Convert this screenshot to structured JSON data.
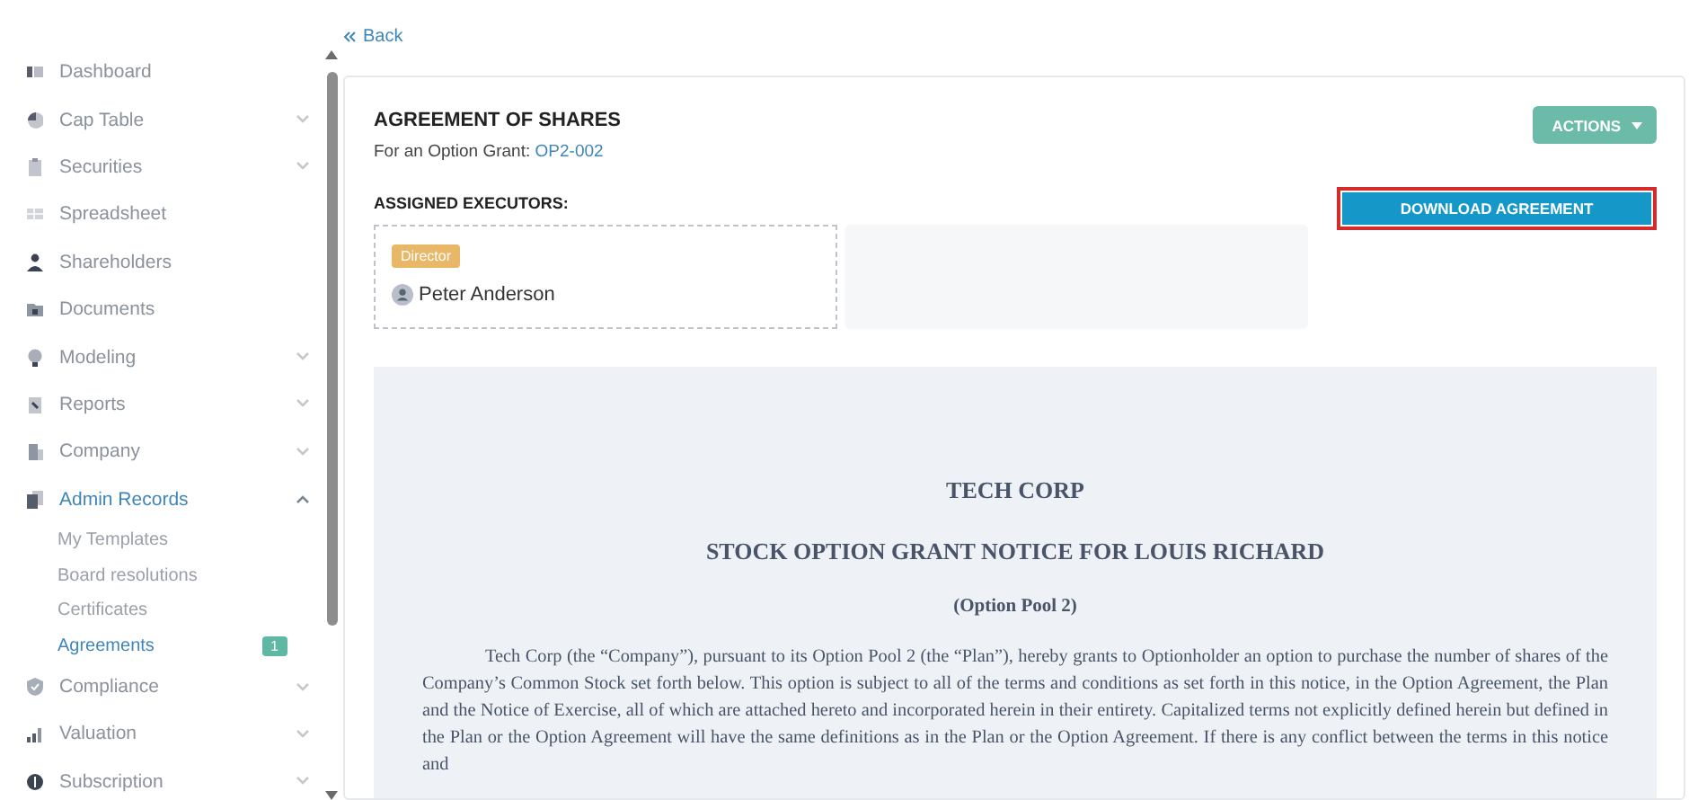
{
  "back_link": "Back",
  "sidebar": {
    "items": [
      {
        "label": "Dashboard",
        "expandable": false,
        "selected": false
      },
      {
        "label": "Cap Table",
        "expandable": true,
        "expanded": false,
        "selected": false
      },
      {
        "label": "Securities",
        "expandable": true,
        "expanded": false,
        "selected": false
      },
      {
        "label": "Spreadsheet",
        "expandable": false,
        "selected": false
      },
      {
        "label": "Shareholders",
        "expandable": false,
        "selected": false
      },
      {
        "label": "Documents",
        "expandable": false,
        "selected": false
      },
      {
        "label": "Modeling",
        "expandable": true,
        "expanded": false,
        "selected": false
      },
      {
        "label": "Reports",
        "expandable": true,
        "expanded": false,
        "selected": false
      },
      {
        "label": "Company",
        "expandable": true,
        "expanded": false,
        "selected": false
      },
      {
        "label": "Admin Records",
        "expandable": true,
        "expanded": true,
        "selected": true,
        "children": [
          {
            "label": "My Templates",
            "selected": false
          },
          {
            "label": "Board resolutions",
            "selected": false
          },
          {
            "label": "Certificates",
            "selected": false
          },
          {
            "label": "Agreements",
            "selected": true,
            "badge": "1"
          }
        ]
      },
      {
        "label": "Compliance",
        "expandable": true,
        "expanded": false,
        "selected": false
      },
      {
        "label": "Valuation",
        "expandable": true,
        "expanded": false,
        "selected": false
      },
      {
        "label": "Subscription",
        "expandable": true,
        "expanded": false,
        "selected": false
      }
    ]
  },
  "card": {
    "title": "AGREEMENT OF SHARES",
    "subtitle": "For an Option Grant:",
    "grant_link": "OP2-002",
    "actions_button": "ACTIONS",
    "executors_label": "ASSIGNED EXECUTORS:",
    "executors": [
      {
        "role": "Director",
        "name": "Peter Anderson"
      }
    ],
    "download_button": {
      "label": "DOWNLOAD AGREEMENT",
      "highlighted": true
    },
    "document": {
      "company": "TECH CORP",
      "heading": "STOCK OPTION GRANT NOTICE FOR LOUIS RICHARD",
      "subheading": "(Option Pool 2)",
      "paragraph": "Tech Corp (the “Company”), pursuant to its Option Pool 2 (the “Plan”), hereby grants to Optionholder an option to purchase the number of shares of the Company’s Common Stock set forth below. This option is subject to all of the terms and conditions as set forth in this notice, in the Option Agreement, the Plan and the Notice of Exercise, all of which are attached hereto and incorporated herein in their entirety. Capitalized terms not explicitly defined herein but defined in the Plan or the Option Agreement will have the same definitions as in the Plan or the Option Agreement. If there is any conflict between the terms in this notice and"
    }
  }
}
